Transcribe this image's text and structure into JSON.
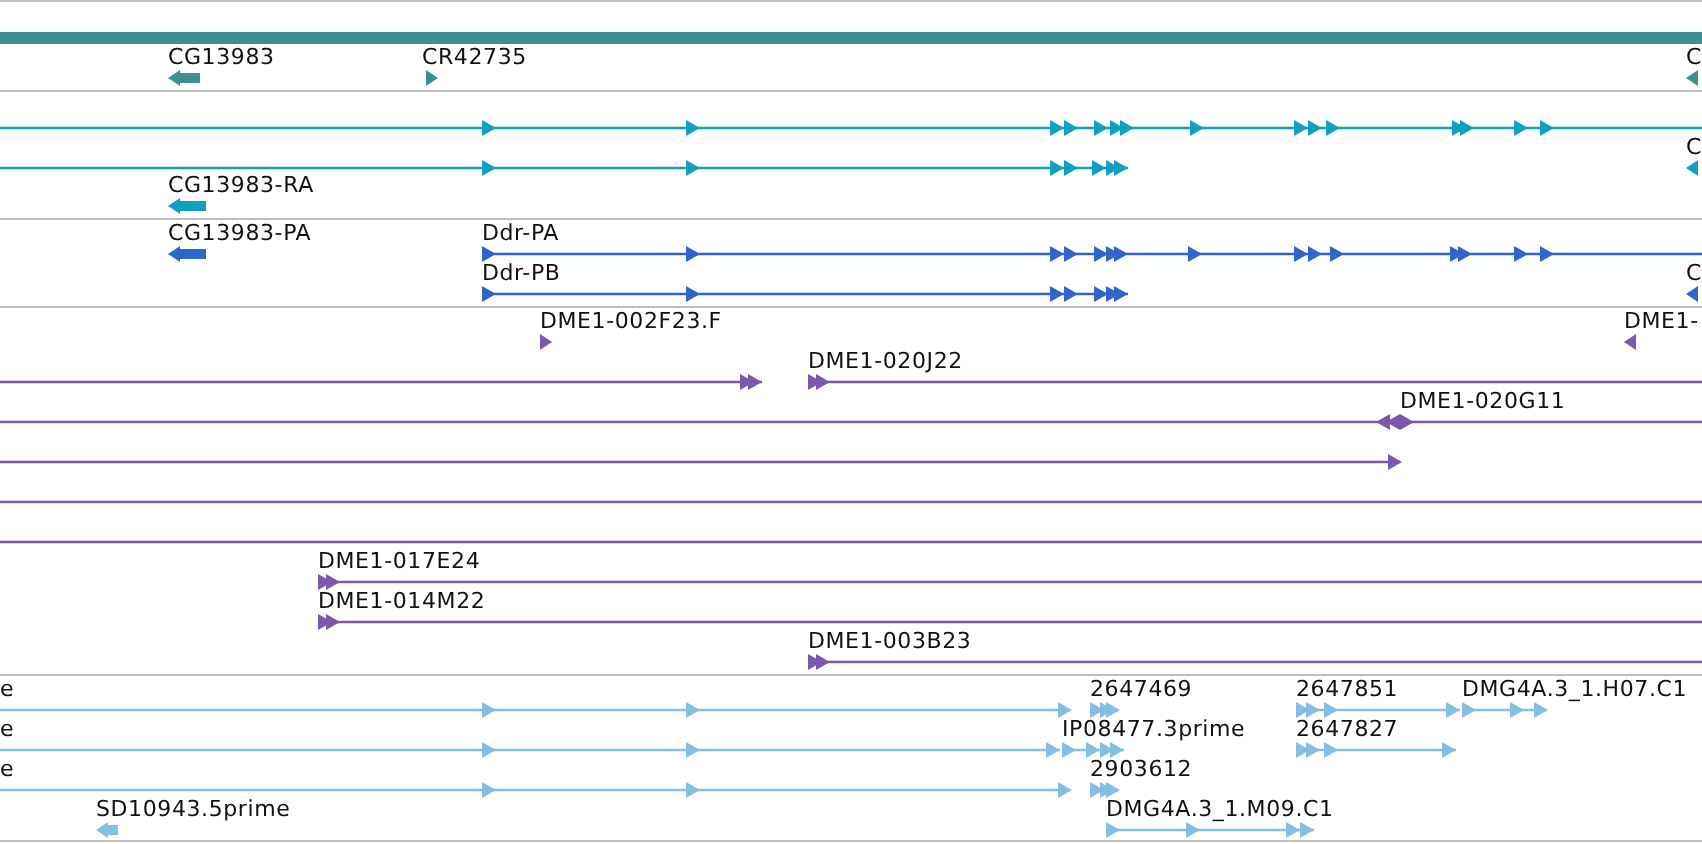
{
  "tracks": [
    {
      "color": "#3f8f91",
      "features": [
        {
          "kind": "block"
        },
        {
          "kind": "gene",
          "label": "CG13983",
          "reverse": true
        },
        {
          "kind": "gene",
          "label": "CR42735",
          "reverse": false
        },
        {
          "kind": "gene",
          "label": "C",
          "reverse": true
        }
      ]
    },
    {
      "color": "#0f9fc0",
      "features": [
        {
          "kind": "transcript",
          "reverse": false
        },
        {
          "kind": "transcript",
          "reverse": false
        },
        {
          "kind": "gene",
          "label": "CG13983-RA",
          "reverse": true
        },
        {
          "kind": "gene",
          "label": "C",
          "reverse": true
        }
      ]
    },
    {
      "color": "#2f66cc",
      "features": [
        {
          "kind": "gene",
          "label": "CG13983-PA",
          "reverse": true
        },
        {
          "kind": "transcript",
          "label": "Ddr-PA",
          "reverse": false
        },
        {
          "kind": "transcript",
          "label": "Ddr-PB",
          "reverse": false
        },
        {
          "kind": "gene",
          "label": "C",
          "reverse": true
        }
      ]
    },
    {
      "color": "#7a58ad",
      "features": [
        {
          "kind": "gene",
          "label": "DME1-002F23.F",
          "reverse": false
        },
        {
          "kind": "gene",
          "label": "DME1-",
          "reverse": true
        },
        {
          "kind": "transcript",
          "reverse": false
        },
        {
          "kind": "transcript",
          "label": "DME1-020J22",
          "reverse": false
        },
        {
          "kind": "transcript",
          "reverse": true
        },
        {
          "kind": "transcript",
          "label": "DME1-020G11",
          "reverse": false
        },
        {
          "kind": "transcript",
          "reverse": false
        },
        {
          "kind": "transcript"
        },
        {
          "kind": "transcript"
        },
        {
          "kind": "transcript",
          "label": "DME1-017E24",
          "reverse": false
        },
        {
          "kind": "transcript",
          "label": "DME1-014M22",
          "reverse": false
        },
        {
          "kind": "transcript",
          "label": "DME1-003B23",
          "reverse": false
        }
      ]
    },
    {
      "color": "#86bde3",
      "features": [
        {
          "kind": "transcript",
          "label": "e",
          "reverse": false
        },
        {
          "kind": "transcript",
          "label": "2647469",
          "reverse": false
        },
        {
          "kind": "transcript",
          "label": "2647851",
          "reverse": false
        },
        {
          "kind": "transcript",
          "label": "DMG4A.3_1.H07.C1",
          "reverse": false
        },
        {
          "kind": "transcript",
          "label": "e",
          "reverse": false
        },
        {
          "kind": "transcript",
          "label": "IP08477.3prime",
          "reverse": false
        },
        {
          "kind": "transcript",
          "label": "2647827",
          "reverse": false
        },
        {
          "kind": "transcript",
          "label": "e",
          "reverse": false
        },
        {
          "kind": "transcript",
          "label": "2903612",
          "reverse": false
        },
        {
          "kind": "gene",
          "label": "SD10943.5prime",
          "reverse": true
        },
        {
          "kind": "transcript",
          "label": "DMG4A.3_1.M09.C1",
          "reverse": false
        }
      ]
    }
  ]
}
